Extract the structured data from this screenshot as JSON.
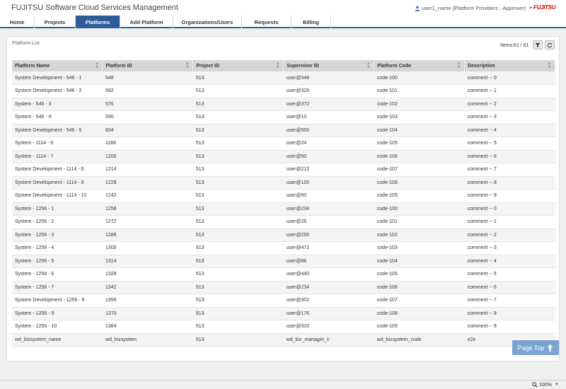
{
  "header": {
    "app_title": "FUJITSU Software Cloud Services Management",
    "user_label": "user1_name (Platform Providers - Approver)",
    "logo_text": "FUJITSU"
  },
  "nav": {
    "tabs": [
      {
        "label": "Home",
        "name": "tab-home"
      },
      {
        "label": "Projects",
        "name": "tab-projects"
      },
      {
        "label": "Platforms",
        "name": "tab-platforms",
        "active": true
      },
      {
        "label": "Add Platform",
        "name": "tab-add-platform"
      },
      {
        "label": "Organizations/Users",
        "name": "tab-organizations-users"
      },
      {
        "label": "Requests",
        "name": "tab-requests"
      },
      {
        "label": "Billing",
        "name": "tab-billing"
      }
    ]
  },
  "panel": {
    "title": "Platform List",
    "items_count": "Items:61 / 61",
    "filter_icon": "filter-icon",
    "refresh_icon": "refresh-icon"
  },
  "table": {
    "columns": [
      "Platform Name",
      "Platform ID",
      "Project ID",
      "Supervisor ID",
      "Platform Code",
      "Description"
    ],
    "rows": [
      [
        "System Development - 546 - 1",
        "548",
        "513",
        "user@346",
        "code-100",
        "comment -- 0"
      ],
      [
        "System Development - 546 - 2",
        "562",
        "513",
        "user@326",
        "code-101",
        "comment -- 1"
      ],
      [
        "System - 546 - 3",
        "576",
        "513",
        "user@372",
        "code-102",
        "comment -- 2"
      ],
      [
        "System - 546 - 4",
        "590",
        "513",
        "user@10",
        "code-103",
        "comment -- 3"
      ],
      [
        "System Development - 546 - 5",
        "604",
        "513",
        "user@500",
        "code-104",
        "comment -- 4"
      ],
      [
        "System - 1114 - 6",
        "1186",
        "513",
        "user@24",
        "code-105",
        "comment -- 5"
      ],
      [
        "System - 1114 - 7",
        "1200",
        "513",
        "user@50",
        "code-106",
        "comment -- 6"
      ],
      [
        "System Development - 1114 - 8",
        "1214",
        "513",
        "user@212",
        "code-107",
        "comment -- 7"
      ],
      [
        "System Development - 1114 - 9",
        "1228",
        "513",
        "user@100",
        "code-108",
        "comment -- 8"
      ],
      [
        "System Development - 1114 - 10",
        "1242",
        "513",
        "user@50",
        "code-109",
        "comment -- 9"
      ],
      [
        "System - 1256 - 1",
        "1258",
        "513",
        "user@234",
        "code-100",
        "comment -- 0"
      ],
      [
        "System - 1256 - 2",
        "1272",
        "513",
        "user@26",
        "code-101",
        "comment -- 1"
      ],
      [
        "System - 1256 - 3",
        "1286",
        "513",
        "user@250",
        "code-102",
        "comment -- 2"
      ],
      [
        "System - 1256 - 4",
        "1300",
        "513",
        "user@472",
        "code-103",
        "comment -- 3"
      ],
      [
        "System - 1256 - 5",
        "1314",
        "513",
        "user@86",
        "code-104",
        "comment -- 4"
      ],
      [
        "System - 1256 - 6",
        "1328",
        "513",
        "user@440",
        "code-105",
        "comment -- 5"
      ],
      [
        "System - 1256 - 7",
        "1342",
        "513",
        "user@234",
        "code-106",
        "comment -- 6"
      ],
      [
        "System Development - 1256 - 8",
        "1356",
        "513",
        "user@302",
        "code-107",
        "comment -- 7"
      ],
      [
        "System - 1256 - 9",
        "1370",
        "513",
        "user@176",
        "code-108",
        "comment -- 8"
      ],
      [
        "System - 1256 - 10",
        "1384",
        "513",
        "user@320",
        "code-109",
        "comment -- 9"
      ],
      [
        "wd_bizsystem_name",
        "wd_bizsystem",
        "513",
        "wd_biz_manager_c",
        "wd_bizsystem_code",
        "e2e"
      ]
    ]
  },
  "page_top": {
    "label": "Page Top"
  },
  "statusbar": {
    "zoom": "100%"
  },
  "colors": {
    "accent": "#2d5d99",
    "link": "#2d6eb5",
    "logo": "#d40000"
  }
}
